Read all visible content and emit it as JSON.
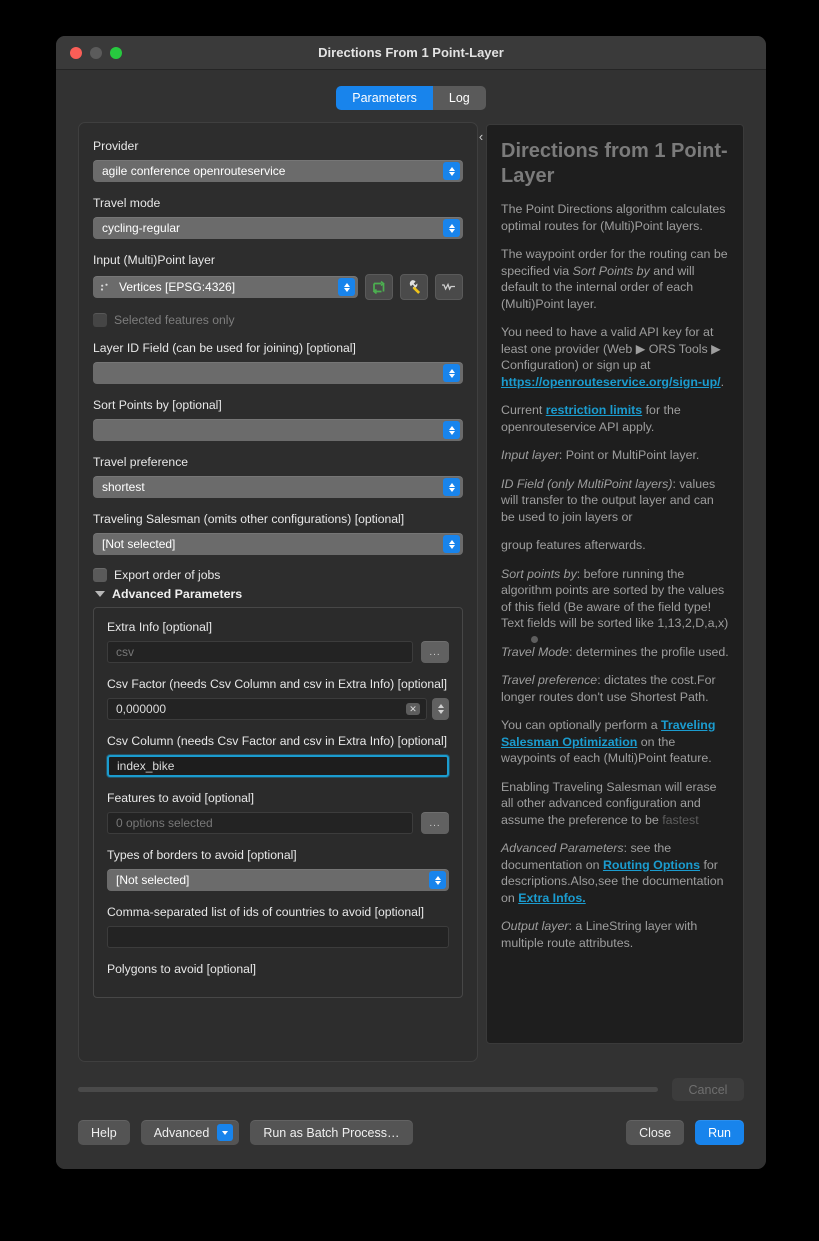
{
  "window": {
    "title": "Directions From 1 Point-Layer",
    "traffic": {
      "close": "close-button",
      "minimize": "minimize-button",
      "zoom": "zoom-button"
    }
  },
  "tabs": [
    {
      "label": "Parameters",
      "active": true
    },
    {
      "label": "Log",
      "active": false
    }
  ],
  "parameters": {
    "provider": {
      "label": "Provider",
      "value": "agile conference openrouteservice"
    },
    "travel_mode": {
      "label": "Travel mode",
      "value": "cycling-regular"
    },
    "input_layer": {
      "label": "Input (Multi)Point layer",
      "value": "Vertices [EPSG:4326]"
    },
    "selected_features_only": {
      "label": "Selected features only",
      "checked": false
    },
    "layer_id_field": {
      "label": "Layer ID Field (can be used for joining) [optional]",
      "value": ""
    },
    "sort_points_by": {
      "label": "Sort Points by [optional]",
      "value": ""
    },
    "travel_preference": {
      "label": "Travel preference",
      "value": "shortest"
    },
    "traveling_salesman": {
      "label": "Traveling Salesman (omits other configurations) [optional]",
      "value": "[Not selected]"
    },
    "export_order_of_jobs": {
      "label": "Export order of jobs",
      "checked": false
    },
    "advanced_header": "Advanced Parameters",
    "extra_info": {
      "label": "Extra Info [optional]",
      "value": "",
      "placeholder": "csv",
      "button": "..."
    },
    "csv_factor": {
      "label": "Csv Factor (needs Csv Column and csv in Extra Info) [optional]",
      "value": "0,000000"
    },
    "csv_column": {
      "label": "Csv Column (needs Csv Factor and csv in Extra Info) [optional]",
      "value": "index_bike",
      "focused": true
    },
    "features_to_avoid": {
      "label": "Features to avoid [optional]",
      "value": "0 options selected",
      "button": "..."
    },
    "types_of_borders": {
      "label": "Types of borders to avoid [optional]",
      "value": "[Not selected]"
    },
    "countries_to_avoid": {
      "label": "Comma-separated list of ids of countries to avoid [optional]",
      "value": ""
    },
    "polygons_to_avoid": {
      "label": "Polygons to avoid [optional]"
    }
  },
  "icons": {
    "iterate": "iterate-over-features-icon",
    "wrench": "advanced-options-icon",
    "data_defined": "data-defined-override-icon",
    "collapse_help": "‹"
  },
  "help": {
    "title": "Directions from 1 Point-Layer",
    "p1": "The Point Directions algorithm calculates optimal routes for (Multi)Point layers.",
    "p2_a": "The waypoint order for the routing can be specified via ",
    "p2_em": "Sort Points by",
    "p2_b": " and will default to the internal order of each (Multi)Point layer.",
    "p3_a": "You need to have a valid API key for at least one provider (Web ▶ ORS Tools ▶ Configuration) or sign up at ",
    "p3_link": "https://openrouteservice.org/sign-up/",
    "p3_b": ".",
    "p4_a": "Current ",
    "p4_link": "restriction limits",
    "p4_b": " for the openrouteservice API apply.",
    "p5_em": "Input layer",
    "p5_b": ": Point or MultiPoint layer.",
    "p6_em": "ID Field (only MultiPoint layers)",
    "p6_b": ": values will transfer to the output layer and can be used to join layers or",
    "p7": "group features afterwards.",
    "p8_em": "Sort points by",
    "p8_b": ": before running the algorithm points are sorted by the values of this field (Be aware of the field type! Text fields will be sorted like 1,13,2,D,a,x)",
    "p9_em": "Travel Mode",
    "p9_b": ": determines the profile used.",
    "p10_em": "Travel preference",
    "p10_b": ": dictates the cost.For longer routes don't use Shortest Path.",
    "p11_a": "You can optionally perform a ",
    "p11_link": "Traveling Salesman Optimization",
    "p11_b": " on the waypoints of each (Multi)Point feature.",
    "p12_a": "Enabling Traveling Salesman will erase all other advanced configuration and assume the preference to be ",
    "p12_faint": "fastest",
    "p13_em": "Advanced Parameters",
    "p13_a": ": see the documentation on ",
    "p13_link1": "Routing Options",
    "p13_b": " for descriptions.Also,see the documentation on ",
    "p13_link2": "Extra Infos.",
    "p14_em": "Output layer",
    "p14_b": ": a LineString layer with multiple route attributes."
  },
  "progress": {
    "value": 0,
    "cancel_label": "Cancel"
  },
  "footer": {
    "help": "Help",
    "advanced": "Advanced",
    "batch": "Run as Batch Process…",
    "close": "Close",
    "run": "Run"
  },
  "colors": {
    "accent": "#1884ec",
    "focus_border": "#1b9ccf",
    "link": "#1b9ccf",
    "window_bg": "#323232",
    "panel_bg": "#2d2d2d",
    "help_bg": "#1e1e1e"
  }
}
